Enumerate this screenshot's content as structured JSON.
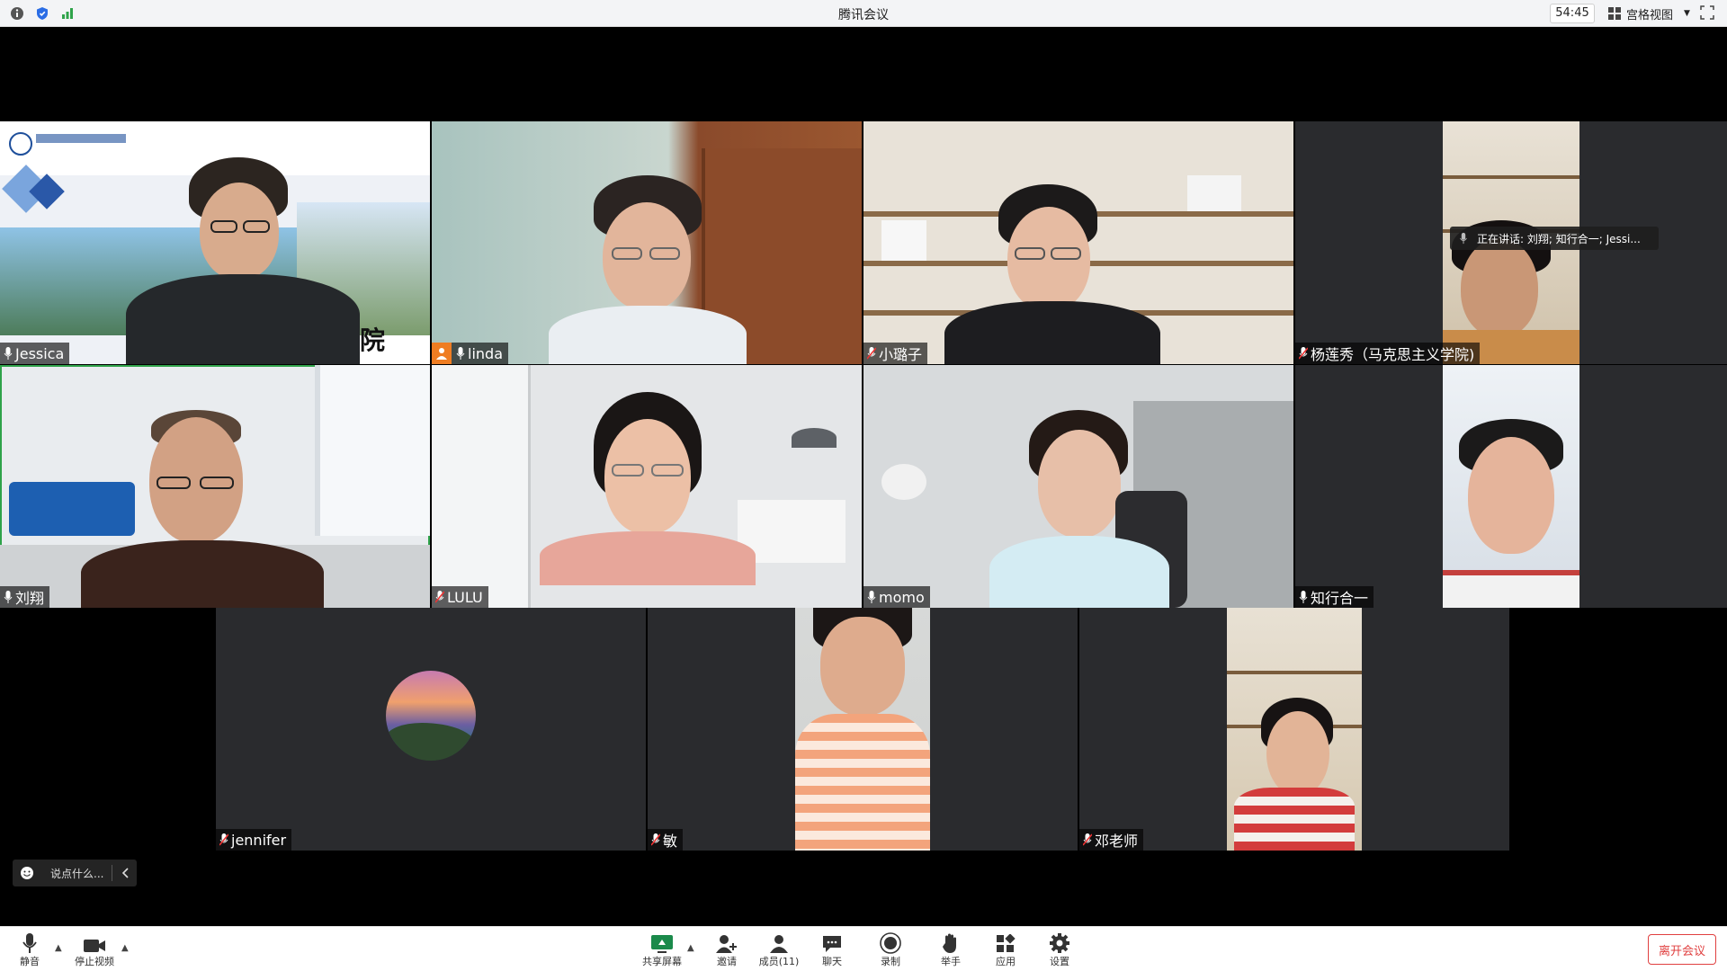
{
  "window": {
    "title": "腾讯会议",
    "timer": "54:45",
    "view_mode": "宫格视图"
  },
  "participants": [
    {
      "name": "Jessica",
      "slide_text": "学院"
    },
    {
      "name": "linda"
    },
    {
      "name": "小璐子"
    },
    {
      "name": "杨莲秀（马克思主义学院)"
    },
    {
      "name": "刘翔"
    },
    {
      "name": "LULU"
    },
    {
      "name": "momo"
    },
    {
      "name": "知行合一"
    },
    {
      "name": "jennifer"
    },
    {
      "name": "敏"
    },
    {
      "name": "邓老师"
    }
  ],
  "speaking": {
    "text": "正在讲话: 刘翔; 知行合一; Jessi..."
  },
  "chat": {
    "placeholder": "说点什么..."
  },
  "toolbar": {
    "mute": "静音",
    "stop_video": "停止视频",
    "share_screen": "共享屏幕",
    "invite": "邀请",
    "members": "成员(11)",
    "chat": "聊天",
    "record": "录制",
    "raise_hand": "举手",
    "apps": "应用",
    "settings": "设置",
    "leave": "离开会议"
  },
  "colors": {
    "active_speaker": "#2fa34a",
    "host_badge": "#ef7d22",
    "leave": "#e04040"
  }
}
